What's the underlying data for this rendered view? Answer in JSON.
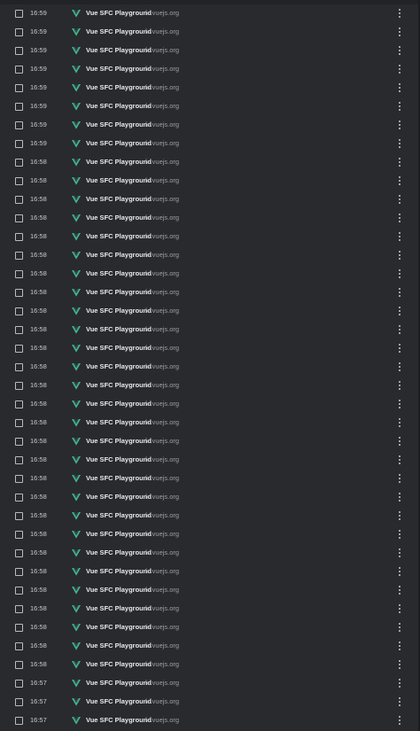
{
  "history": {
    "title": "Vue SFC Playground",
    "domain": "sfc.vuejs.org",
    "favicon_icon": "vue-logo-icon",
    "menu_icon": "more-vert-icon",
    "favicon_colors": {
      "outer": "#41b883",
      "inner": "#35495e"
    },
    "entries": [
      {
        "time": "16:59"
      },
      {
        "time": "16:59"
      },
      {
        "time": "16:59"
      },
      {
        "time": "16:59"
      },
      {
        "time": "16:59"
      },
      {
        "time": "16:59"
      },
      {
        "time": "16:59"
      },
      {
        "time": "16:59"
      },
      {
        "time": "16:58"
      },
      {
        "time": "16:58"
      },
      {
        "time": "16:58"
      },
      {
        "time": "16:58"
      },
      {
        "time": "16:58"
      },
      {
        "time": "16:58"
      },
      {
        "time": "16:58"
      },
      {
        "time": "16:58"
      },
      {
        "time": "16:58"
      },
      {
        "time": "16:58"
      },
      {
        "time": "16:58"
      },
      {
        "time": "16:58"
      },
      {
        "time": "16:58"
      },
      {
        "time": "16:58"
      },
      {
        "time": "16:58"
      },
      {
        "time": "16:58"
      },
      {
        "time": "16:58"
      },
      {
        "time": "16:58"
      },
      {
        "time": "16:58"
      },
      {
        "time": "16:58"
      },
      {
        "time": "16:58"
      },
      {
        "time": "16:58"
      },
      {
        "time": "16:58"
      },
      {
        "time": "16:58"
      },
      {
        "time": "16:58"
      },
      {
        "time": "16:58"
      },
      {
        "time": "16:58"
      },
      {
        "time": "16:58"
      },
      {
        "time": "16:57"
      },
      {
        "time": "16:57"
      },
      {
        "time": "16:57"
      }
    ]
  }
}
